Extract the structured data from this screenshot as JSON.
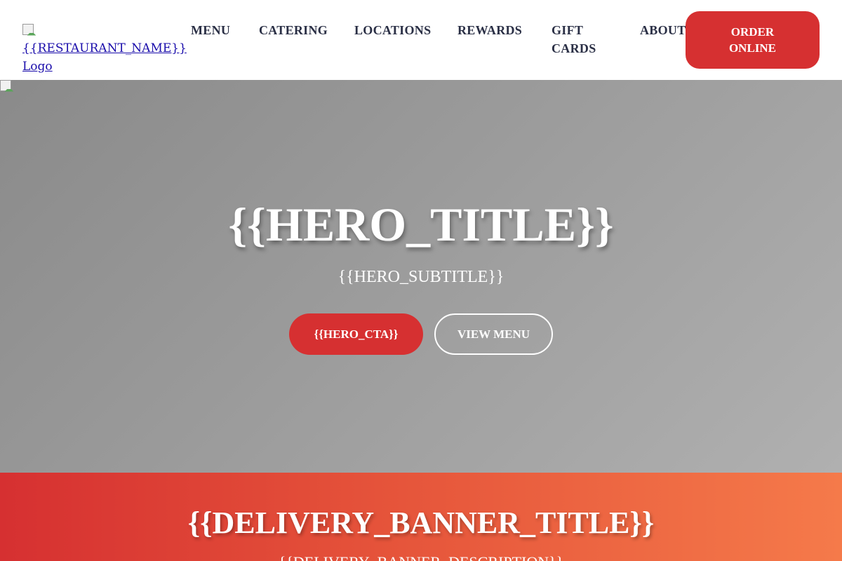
{
  "header": {
    "logo_alt": "{{RESTAURANT_NAME}} Logo",
    "nav": {
      "menu": "MENU",
      "catering": "CATERING",
      "locations": "LOCATIONS",
      "rewards": "REWARDS",
      "gift_cards": "GIFT CARDS",
      "about": "ABOUT"
    },
    "order_button": "ORDER ONLINE"
  },
  "hero": {
    "title": "{{HERO_TITLE}}",
    "subtitle": "{{HERO_SUBTITLE}}",
    "cta_label": "{{HERO_CTA}}",
    "view_menu_label": "VIEW MENU",
    "background_gradient": [
      "#8a8a8a",
      "#b0b0b0"
    ]
  },
  "delivery_banner": {
    "title": "{{DELIVERY_BANNER_TITLE}}",
    "description": "{{DELIVERY_BANNER_DESCRIPTION}}",
    "gradient": [
      "#d63031",
      "#f57a4a"
    ]
  },
  "colors": {
    "accent": "#d63031",
    "nav_text": "#2a2f45",
    "link": "#1a0dab"
  }
}
